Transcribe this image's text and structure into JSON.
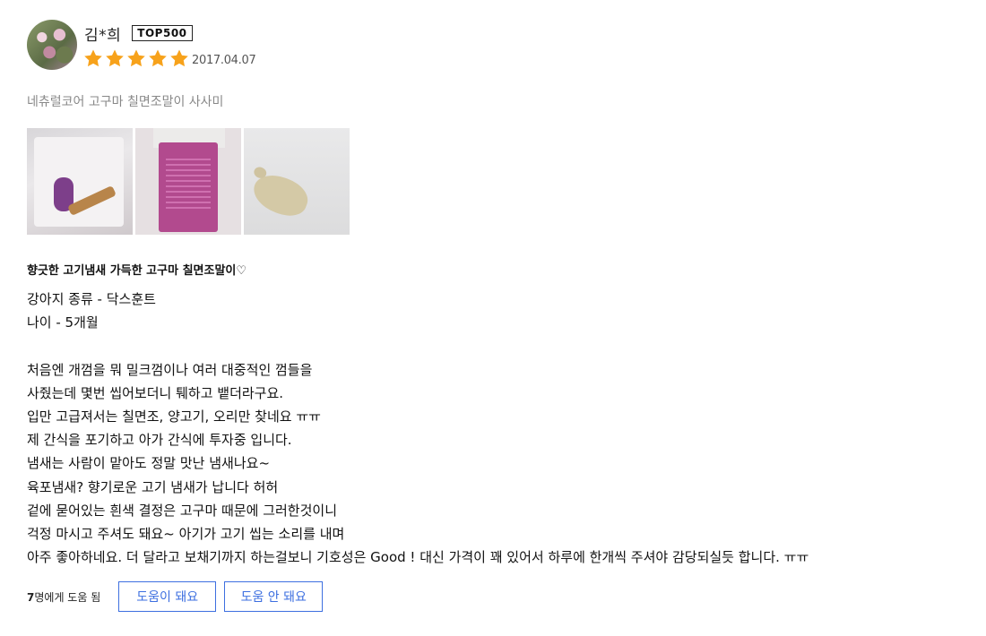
{
  "reviewer": {
    "name": "김*희",
    "badge": "TOP500"
  },
  "rating": {
    "stars": 5,
    "max_stars": 5,
    "star_color": "#f7a21b"
  },
  "date": "2017.04.07",
  "product_name": "네츄럴코어 고구마 칠면조말이 사사미",
  "photos": [
    {
      "icon": "product-photo-bag-front"
    },
    {
      "icon": "product-photo-bag-back"
    },
    {
      "icon": "product-photo-turkey-illustration"
    }
  ],
  "review_title": "향긋한 고기냄새 가득한 고구마 칠면조말이♡",
  "review_body": [
    "강아지 종류 - 닥스훈트",
    "나이 - 5개월",
    "",
    "처음엔 개껌을 뭐 밀크껌이나 여러 대중적인 껌들을",
    "사줬는데 몇번 씹어보더니 퉤하고 뱉더라구요.",
    "입만 고급져서는 칠면조, 양고기, 오리만 찾네요 ㅠㅠ",
    "제 간식을 포기하고 아가 간식에 투자중 입니다.",
    "냄새는 사람이 맡아도 정말 맛난 냄새나요~",
    "육포냄새? 향기로운 고기 냄새가 납니다 허허",
    "겉에 묻어있는 흰색 결정은 고구마 때문에 그러한것이니",
    "걱정 마시고 주셔도 돼요~ 아기가 고기 씹는 소리를 내며",
    "아주 좋아하네요. 더 달라고 보채기까지 하는걸보니 기호성은 Good ! 대신 가격이 꽤 있어서 하루에 한개씩 주셔야 감당되실듯 합니다. ㅠㅠ"
  ],
  "helpful": {
    "count": "7",
    "count_suffix": "명에게 도움 됨",
    "yes_label": "도움이 돼요",
    "no_label": "도움 안 돼요",
    "button_color": "#3d6fe0"
  }
}
